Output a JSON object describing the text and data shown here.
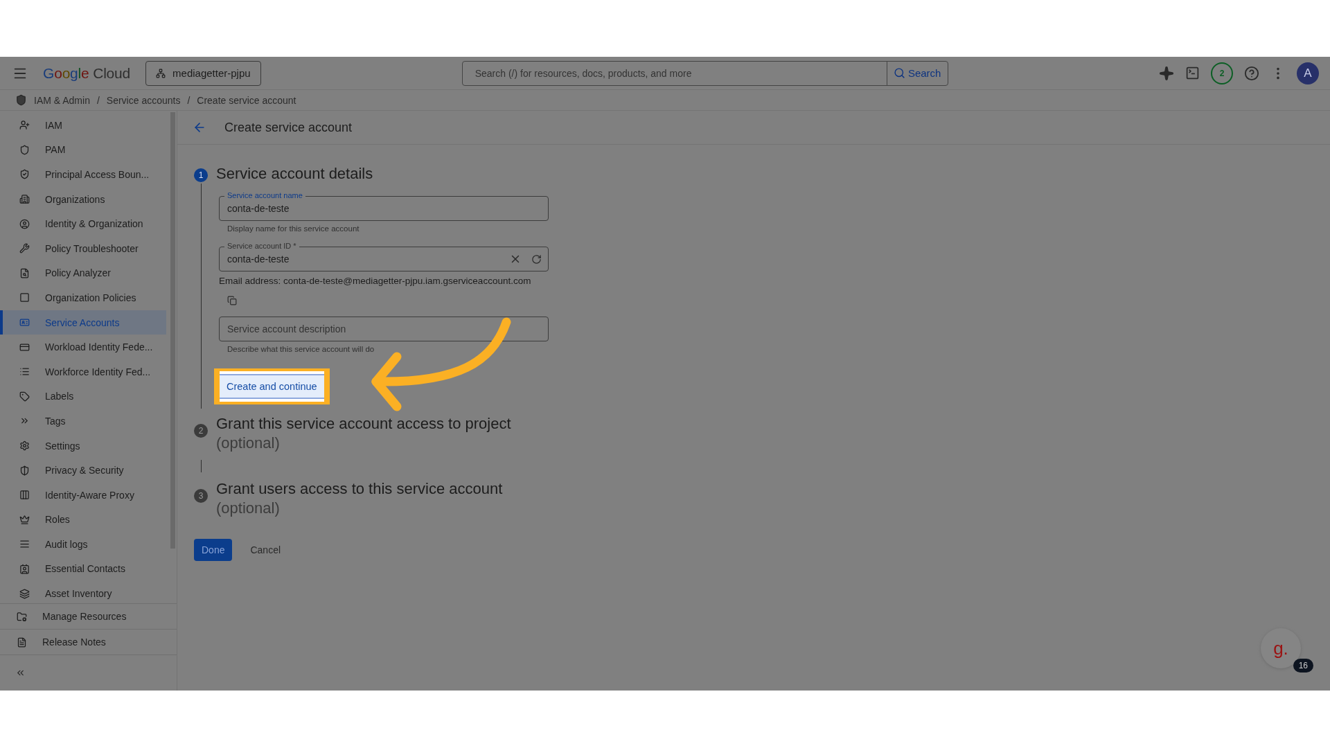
{
  "topbar": {
    "logo": {
      "brand": "Google",
      "product": "Cloud"
    },
    "project": "mediagetter-pjpu",
    "search": {
      "placeholder": "Search (/) for resources, docs, products, and more",
      "button": "Search"
    },
    "notifications": "2",
    "avatar": "A"
  },
  "breadcrumb": {
    "separator": "/",
    "items": [
      "IAM & Admin",
      "Service accounts",
      "Create service account"
    ]
  },
  "sidebar": {
    "items": [
      {
        "label": "IAM",
        "selected": false
      },
      {
        "label": "PAM",
        "selected": false
      },
      {
        "label": "Principal Access Boun...",
        "selected": false
      },
      {
        "label": "Organizations",
        "selected": false
      },
      {
        "label": "Identity & Organization",
        "selected": false
      },
      {
        "label": "Policy Troubleshooter",
        "selected": false
      },
      {
        "label": "Policy Analyzer",
        "selected": false
      },
      {
        "label": "Organization Policies",
        "selected": false
      },
      {
        "label": "Service Accounts",
        "selected": true
      },
      {
        "label": "Workload Identity Fede...",
        "selected": false
      },
      {
        "label": "Workforce Identity Fed...",
        "selected": false
      },
      {
        "label": "Labels",
        "selected": false
      },
      {
        "label": "Tags",
        "selected": false
      },
      {
        "label": "Settings",
        "selected": false
      },
      {
        "label": "Privacy & Security",
        "selected": false
      },
      {
        "label": "Identity-Aware Proxy",
        "selected": false
      },
      {
        "label": "Roles",
        "selected": false
      },
      {
        "label": "Audit logs",
        "selected": false
      },
      {
        "label": "Essential Contacts",
        "selected": false
      },
      {
        "label": "Asset Inventory",
        "selected": false
      }
    ],
    "footer": [
      "Manage Resources",
      "Release Notes"
    ]
  },
  "page": {
    "title": "Create service account",
    "steps": [
      {
        "number": "1",
        "title": "Service account details",
        "active": true
      },
      {
        "number": "2",
        "title": "Grant this service account access to project",
        "subtitle": "(optional)",
        "active": false
      },
      {
        "number": "3",
        "title": "Grant users access to this service account",
        "subtitle": "(optional)",
        "active": false
      }
    ],
    "fields": [
      {
        "kind": "name",
        "label": "Service account name",
        "value": "conta-de-teste",
        "hint": "Display name for this service account"
      },
      {
        "kind": "id",
        "label": "Service account ID *",
        "value": "conta-de-teste",
        "email": "Email address: conta-de-teste@mediagetter-pjpu.iam.gserviceaccount.com"
      },
      {
        "kind": "description",
        "placeholder": "Service account description",
        "hint": "Describe what this service account will do"
      }
    ],
    "continue_button": "Create and continue",
    "buttons": [
      "Done",
      "Cancel"
    ]
  },
  "assistant": {
    "logo": "g.",
    "badge": "16"
  }
}
